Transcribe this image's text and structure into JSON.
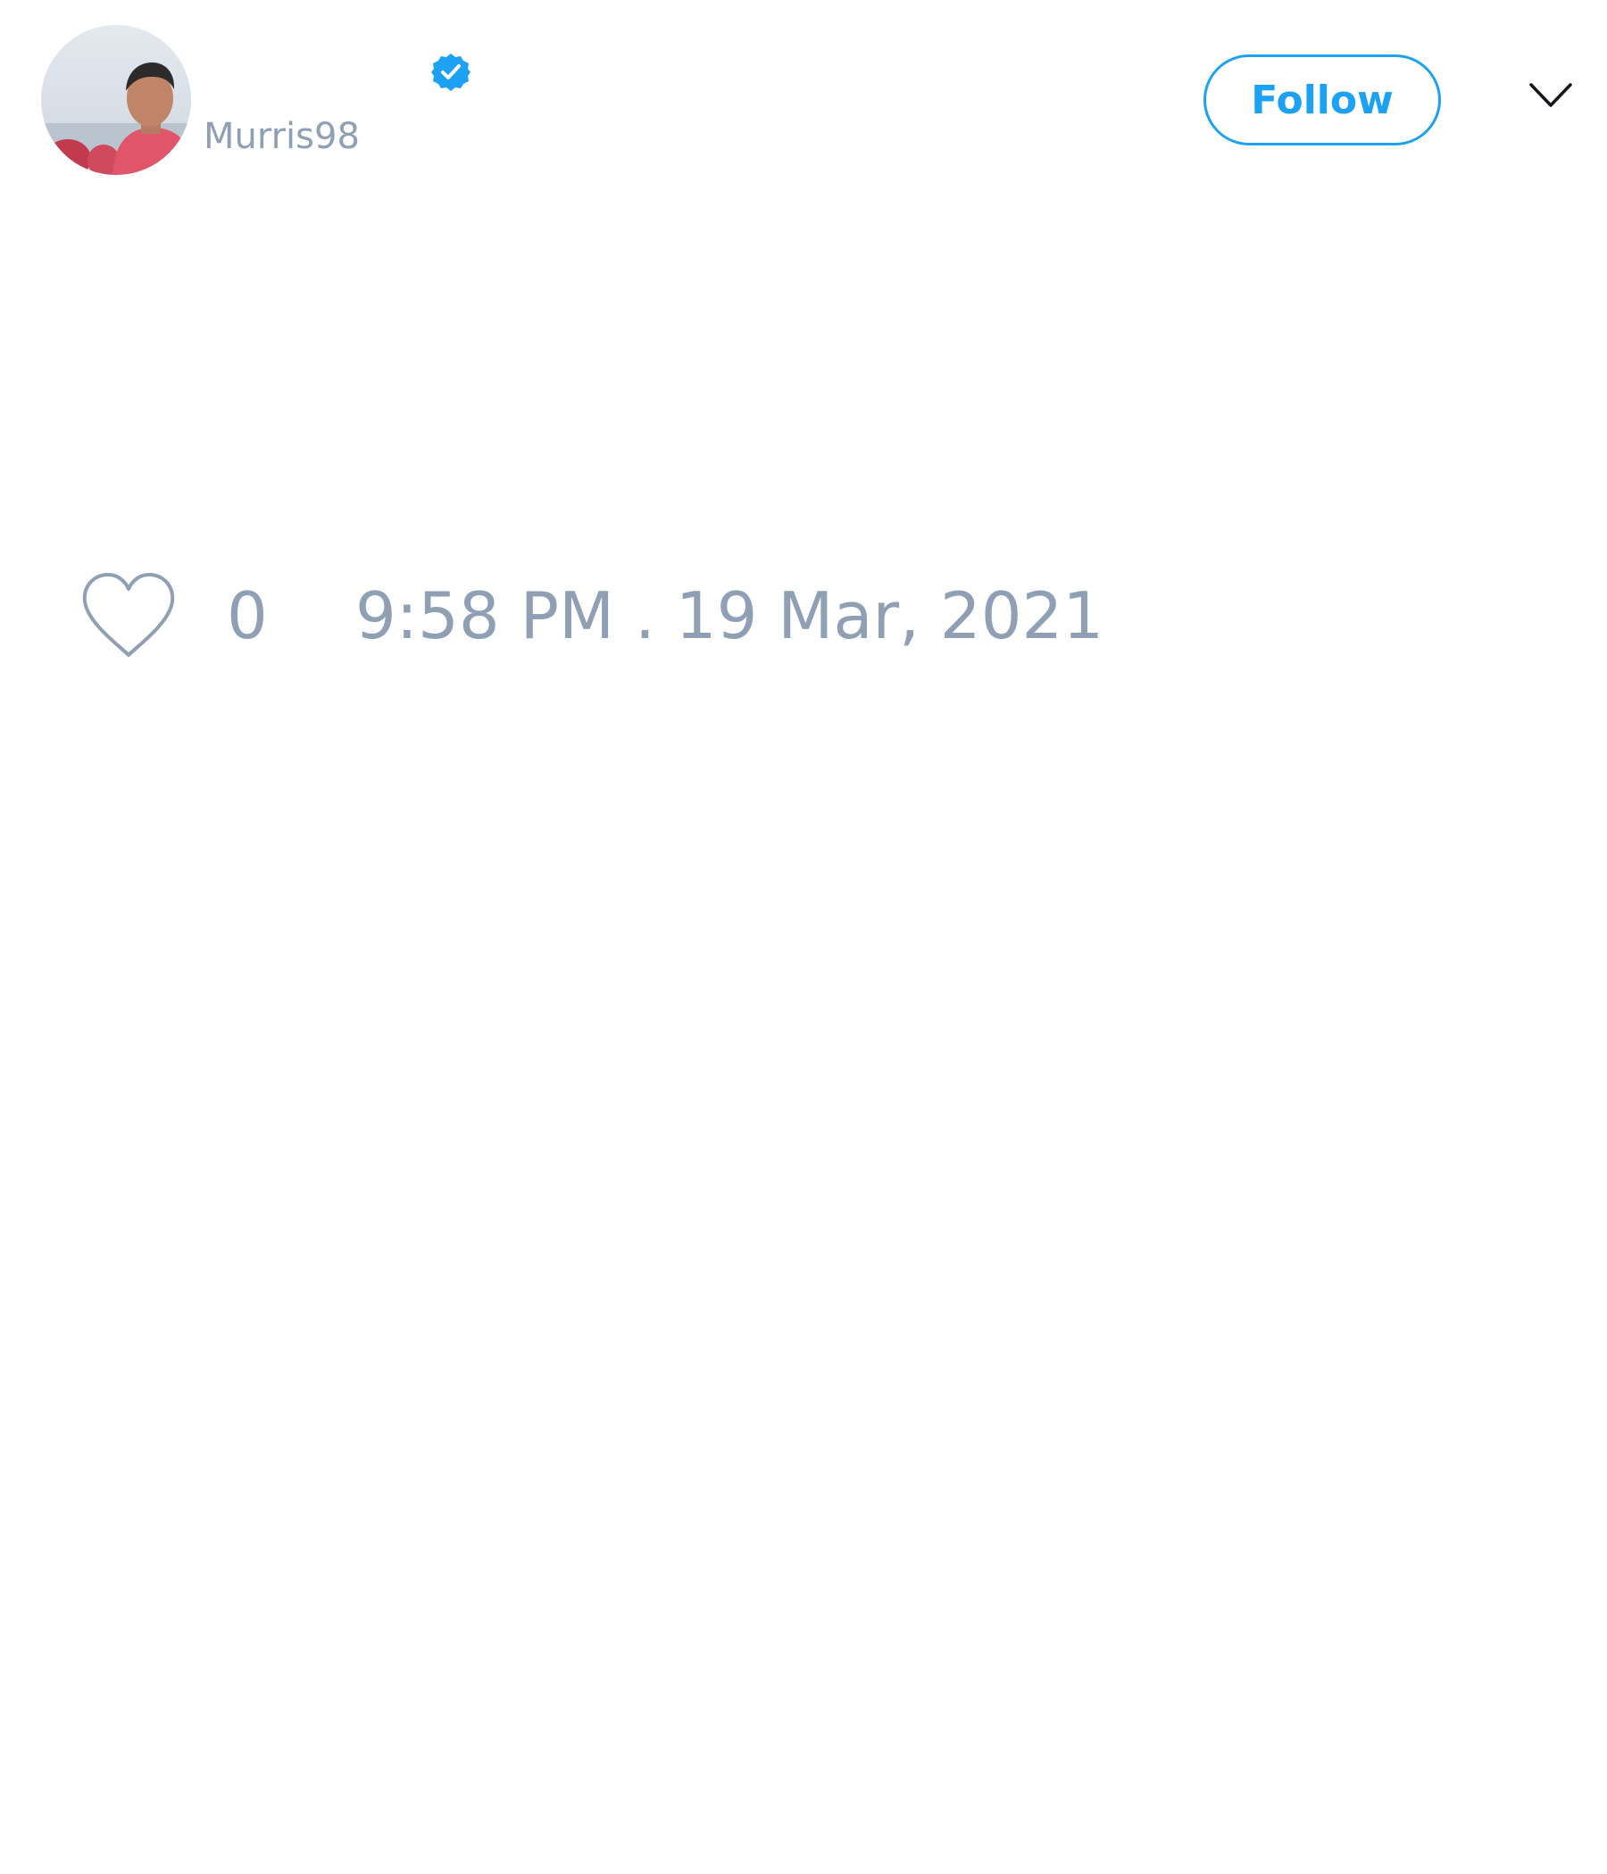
{
  "tweet": {
    "author": {
      "handle": "Murris98",
      "verified": true
    },
    "follow_label": "Follow",
    "likes_count": "0",
    "timestamp": "9:58 PM . 19 Mar, 2021"
  },
  "colors": {
    "accent": "#1da1f2",
    "muted_text": "#8fa0b5",
    "background": "#ffffff"
  },
  "icons": {
    "verified": "verified-badge-icon",
    "menu": "chevron-down-icon",
    "like": "heart-icon"
  }
}
